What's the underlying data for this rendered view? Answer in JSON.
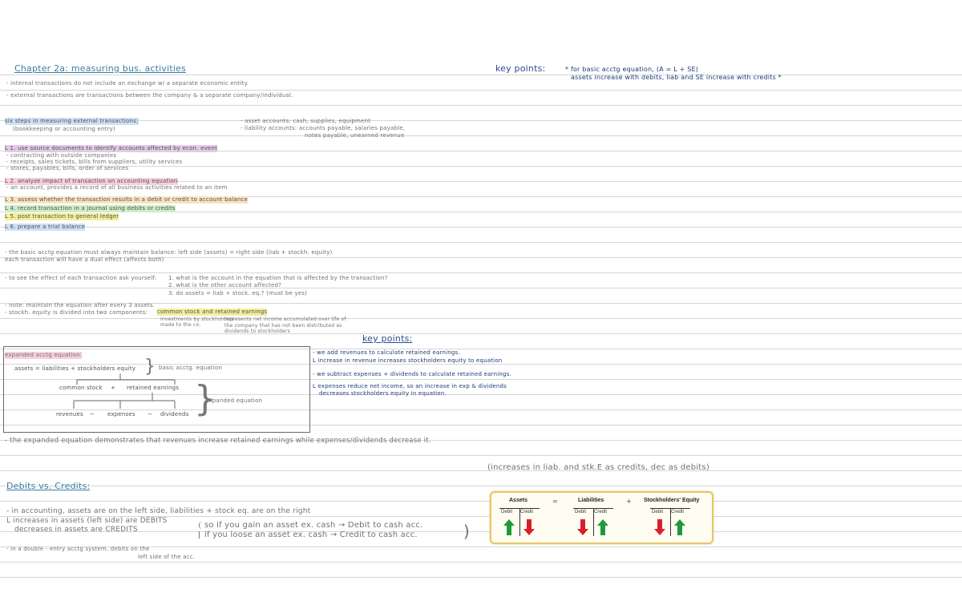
{
  "notes": {
    "title": "Chapter 2a: measuring bus. activities",
    "internal": "- internal transactions do not include an exchange w/ a separate economic entity.",
    "external": "- external transactions are transactions between the company & a separate company/individual.",
    "six_steps_heading": "six steps in measuring external transactions:",
    "six_steps_sub": "(bookkeeping or accounting entry)",
    "asset_accounts": "- asset accounts: cash, supplies, equipment",
    "liability_accounts": "- liability accounts: accounts payable, salaries payable,",
    "liability_accounts_cont": "notes payable, unearned revenue",
    "step1": "L 1. use source documents to identify accounts affected by econ. event",
    "step1_a": "- contracting with outside companies",
    "step1_b": "- receipts, sales tickets, bills from suppliers, utility services",
    "step1_c": "- stores, payables, bills, order of services",
    "step2": "L 2. analyze impact of transaction on accounting equation",
    "step2_a": "- an account, provides a record of all business activities related to an item",
    "step3": "L 3. assess whether the transaction results in a debit or credit to account balance",
    "step4": "L 4. record transaction in a journal using debits or credits",
    "step5": "L 5. post transaction to general ledger",
    "step6": "L 6. prepare a trial balance",
    "basic_eq": "- the basic acctg equation must always maintain balance: left side (assets) = right side (liab + stockh. equity)",
    "basic_eq_b": "each transaction will have a dual effect (affects both)",
    "effect": "- to see the effect of each transaction ask yourself:",
    "q1": "1. what is the account in the equation that is affected by the transaction?",
    "q2": "2. what is the other account affected?",
    "q3": "3. do assets = liab + stock. eq.? (must be yes)",
    "three_parts": "- note: maintain the equation after every 3 assets.",
    "split": "- stockh. equity is divided into two components:",
    "common_stock_retained": "common stock and retained earnings",
    "cs_note": "investments by stockholders",
    "cs_note_b": "made to the co.",
    "re_note": "represents net income accumulated over life of",
    "re_note_b": "the company that has not been distributed as",
    "re_note_c": "dividends to stockholders",
    "key_points_label": "key points:",
    "key_points_1": "* for basic acctg equation, (A = L + SE)",
    "key_points_1b": "assets increase with debits, liab and SE increase with credits *",
    "key_points_2_label": "key points:",
    "kp2_a": "- we add revenues to calculate retained earnings.",
    "kp2_b": "L increase in revenue increases stockholders equity to equation",
    "kp2_c": "- we subtract expenses + dividends to calculate retained earnings.",
    "kp2_d": "L expenses reduce net income, so an increase in exp & dividends",
    "kp2_e": "decreases stockholders equity in equation.",
    "expanded_title": "expanded acctg equation:",
    "exp_row1": "assets = liabilities + stockholders equity",
    "exp_basic": "basic acctg. equation",
    "exp_cs": "common stock",
    "exp_plus": "+",
    "exp_re": "retained earnings",
    "exp_rev": "revenues",
    "exp_minus1": "−",
    "exp_exp": "expenses",
    "exp_minus2": "−",
    "exp_div": "dividends",
    "exp_expanded": "expanded equation",
    "summary": "- the expanded equation demonstrates that revenues increase retained earnings while expenses/dividends decrease it.",
    "inc_liab": "(increases in liab. and stk.E as credits, dec as debits)",
    "debits_title": "Debits vs. Credits:",
    "dc_1": "- in accounting, assets are on the left side, liabilities + stock eq. are on the right",
    "dc_2": "L increases in assets (left side) are DEBITS",
    "dc_3": "decreases in assets are CREDITS",
    "dc_4": "so if you gain an asset ex. cash → Debit to cash acc.",
    "dc_5": "if you loose an asset ex. cash → Credit to cash acc.",
    "dc_6": "- in a double - entry acctg system, debits on the",
    "dc_7": "left side of the acc."
  },
  "figure": {
    "assets": "Assets",
    "eq": "=",
    "liabilities": "Liabilities",
    "plus": "+",
    "se": "Stockholders' Equity",
    "debit": "Debit",
    "credit": "Credit",
    "colors": {
      "up": "#1f9a3a",
      "down": "#d8202b",
      "border": "#e7c56a"
    },
    "arrows": {
      "assets": [
        "up-icon",
        "down-icon"
      ],
      "liabilities": [
        "down-icon",
        "up-icon"
      ],
      "stockholders_equity": [
        "down-icon",
        "up-icon"
      ]
    }
  }
}
